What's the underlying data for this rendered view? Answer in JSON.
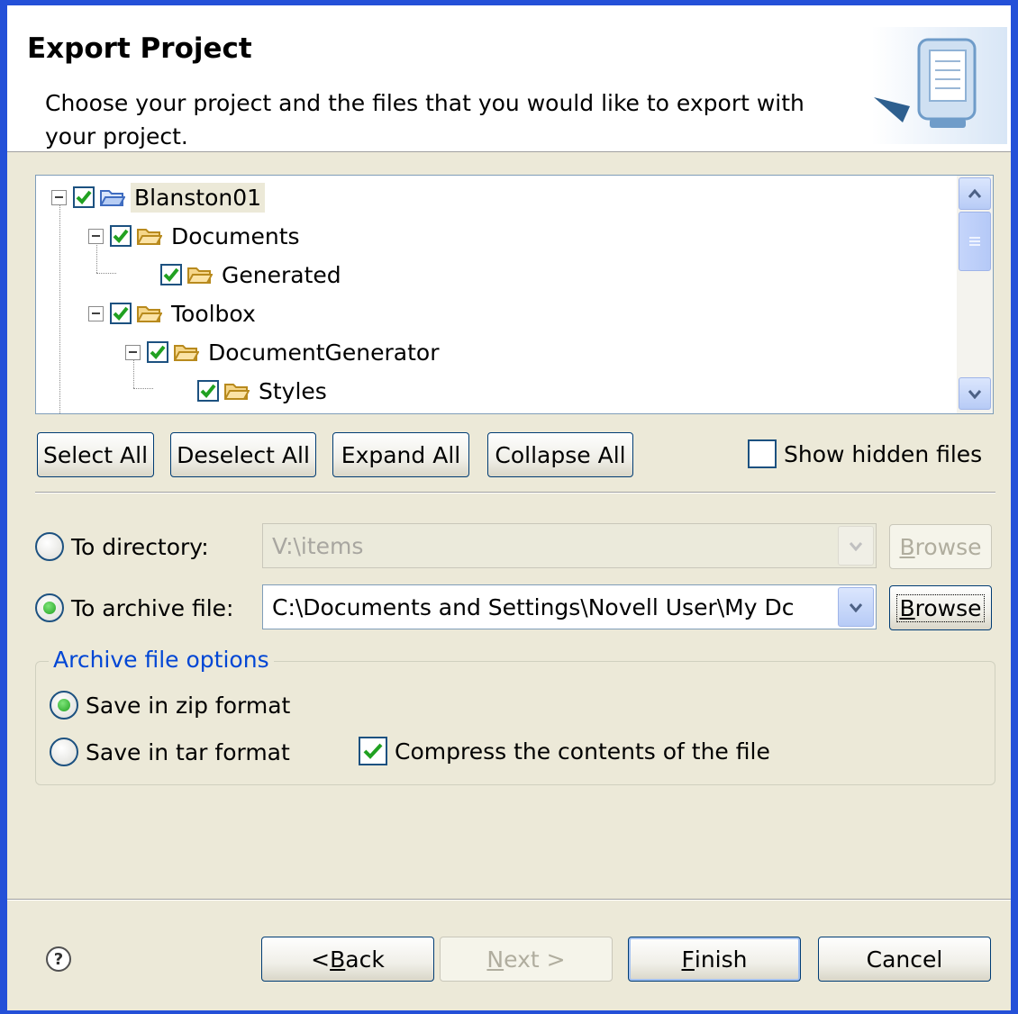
{
  "header": {
    "title": "Export Project",
    "description": "Choose your project and the files that you would like to export with your project."
  },
  "tree": {
    "items": [
      {
        "label": "Blanston01",
        "checked": true,
        "expanded": true
      },
      {
        "label": "Documents",
        "checked": true,
        "expanded": true
      },
      {
        "label": "Generated",
        "checked": true
      },
      {
        "label": "Toolbox",
        "checked": true,
        "expanded": true
      },
      {
        "label": "DocumentGenerator",
        "checked": true,
        "expanded": true
      },
      {
        "label": "Styles",
        "checked": true
      }
    ]
  },
  "tree_buttons": {
    "select_all": "Select All",
    "deselect_all": "Deselect All",
    "expand_all": "Expand All",
    "collapse_all": "Collapse All"
  },
  "show_hidden": {
    "label": "Show hidden files",
    "checked": false
  },
  "destination": {
    "to_directory_label": "To directory:",
    "to_directory_value": "V:\\items",
    "to_archive_label": "To archive file:",
    "to_archive_value": "C:\\Documents and Settings\\Novell User\\My Dc",
    "browse_b": "B",
    "browse_rest": "rowse",
    "selected": "archive"
  },
  "archive_options": {
    "legend": "Archive file options",
    "zip_label": "Save in zip format",
    "tar_label": "Save in tar format",
    "compress_label": "Compress the contents of the file",
    "format": "zip",
    "compress": true
  },
  "footer": {
    "help": "?",
    "back_prefix": "< ",
    "back_mnemonic": "B",
    "back_rest": "ack",
    "next_mnemonic": "N",
    "next_rest": "ext >",
    "finish_mnemonic": "F",
    "finish_rest": "inish",
    "cancel": "Cancel"
  },
  "colors": {
    "accent_blue": "#2450d8",
    "dialog_bg": "#ece9d8",
    "check_green": "#21a121",
    "group_legend": "#0046d5"
  }
}
